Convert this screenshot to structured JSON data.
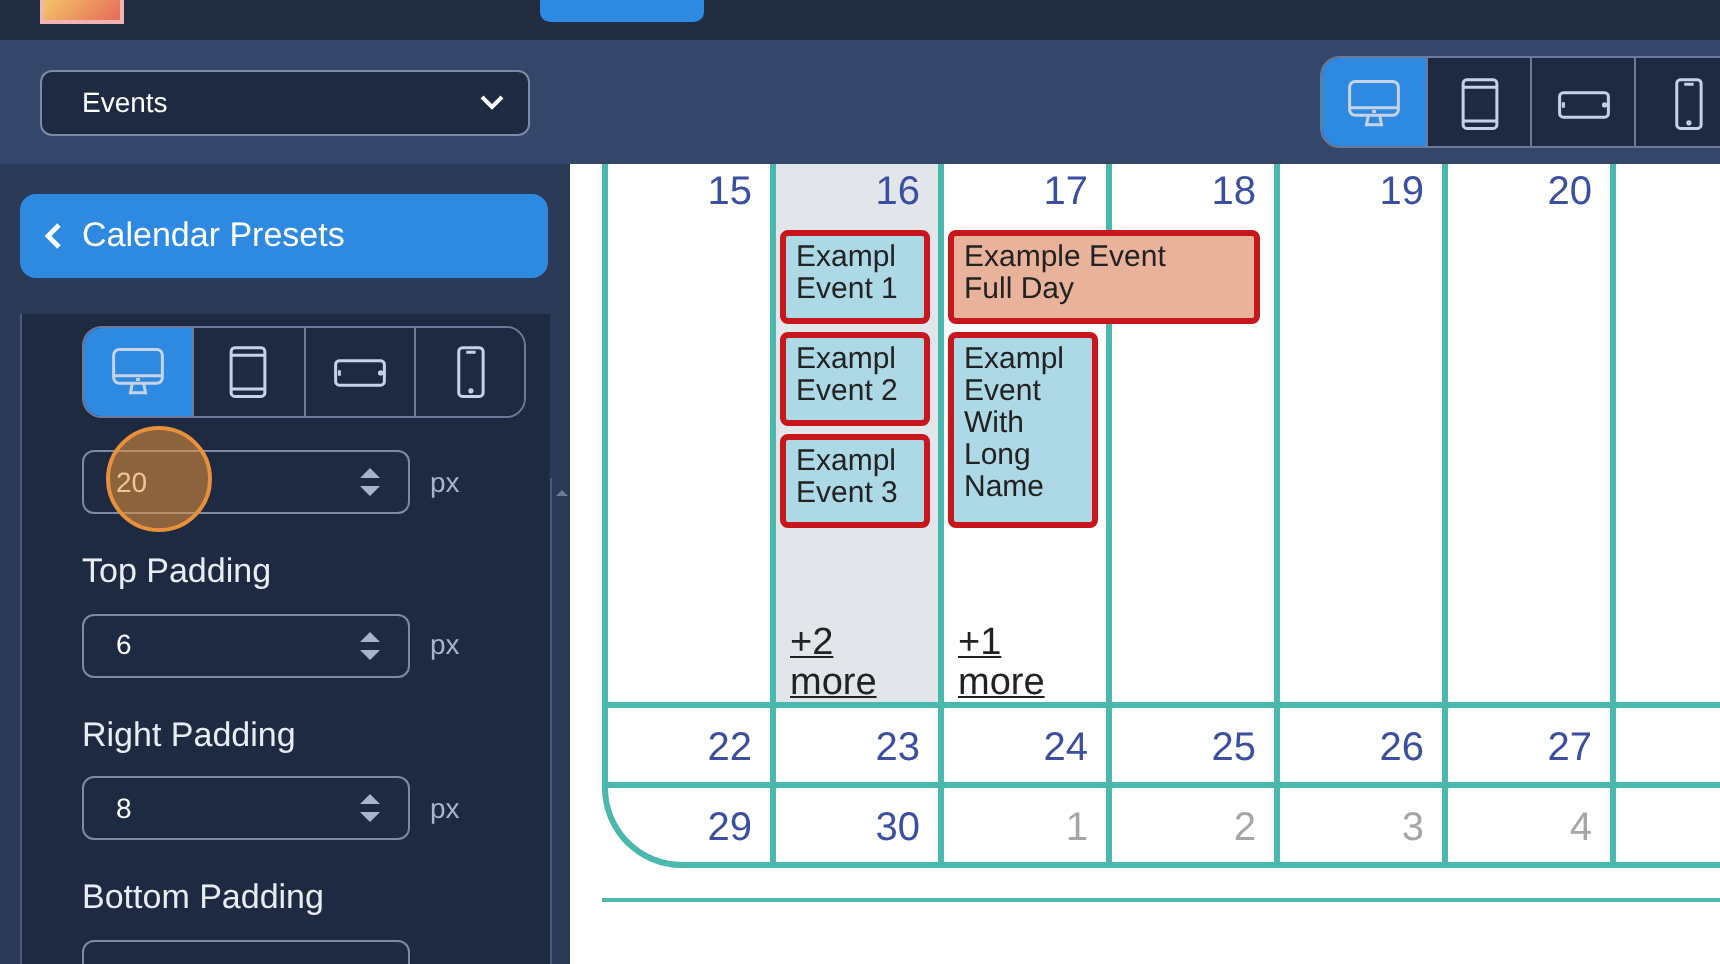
{
  "toolbar": {
    "view_select": {
      "value": "Events"
    },
    "devices": [
      {
        "kind": "desktop",
        "selected": true
      },
      {
        "kind": "tablet",
        "selected": false
      },
      {
        "kind": "landscape",
        "selected": false
      },
      {
        "kind": "phone",
        "selected": false
      }
    ]
  },
  "sidebar": {
    "back_button": {
      "label": "Calendar Presets"
    },
    "devices": [
      {
        "kind": "desktop",
        "selected": true
      },
      {
        "kind": "tablet",
        "selected": false
      },
      {
        "kind": "landscape",
        "selected": false
      },
      {
        "kind": "phone",
        "selected": false
      }
    ],
    "fields": [
      {
        "value": "20",
        "unit": "px"
      },
      {
        "label": "Top Padding",
        "value": "6",
        "unit": "px"
      },
      {
        "label": "Right Padding",
        "value": "8",
        "unit": "px"
      },
      {
        "label": "Bottom Padding"
      }
    ]
  },
  "calendar": {
    "weeks": [
      {
        "days": [
          {
            "day": "15",
            "muted": false,
            "selected": false
          },
          {
            "day": "16",
            "muted": false,
            "selected": true,
            "events": [
              {
                "kind": "single",
                "title": "Exampl Event 1",
                "color": "#add8e6"
              },
              {
                "kind": "single",
                "title": "Exampl Event 2",
                "color": "#add8e6"
              },
              {
                "kind": "single",
                "title": "Exampl Event 3",
                "color": "#add8e6"
              }
            ],
            "more": "+2 more"
          },
          {
            "day": "17",
            "muted": false,
            "selected": false,
            "events": [
              {
                "kind": "wide",
                "title": "Example Event Full Day",
                "color": "#e9b39b"
              },
              {
                "kind": "tall",
                "title": "Exampl Event With Long Name",
                "color": "#add8e6"
              }
            ],
            "more": "+1 more"
          },
          {
            "day": "18",
            "muted": false,
            "selected": false
          },
          {
            "day": "19",
            "muted": false,
            "selected": false
          },
          {
            "day": "20",
            "muted": false,
            "selected": false
          },
          {
            "selected": false
          }
        ]
      },
      {
        "days": [
          {
            "day": "22",
            "muted": false,
            "selected": false
          },
          {
            "day": "23",
            "muted": false,
            "selected": false
          },
          {
            "day": "24",
            "muted": false,
            "selected": false
          },
          {
            "day": "25",
            "muted": false,
            "selected": false
          },
          {
            "day": "26",
            "muted": false,
            "selected": false
          },
          {
            "day": "27",
            "muted": false,
            "selected": false
          },
          {
            "selected": false
          }
        ]
      },
      {
        "days": [
          {
            "day": "29",
            "muted": false,
            "selected": false
          },
          {
            "day": "30",
            "muted": false,
            "selected": false
          },
          {
            "day": "1",
            "muted": true,
            "selected": false
          },
          {
            "day": "2",
            "muted": true,
            "selected": false
          },
          {
            "day": "3",
            "muted": true,
            "selected": false
          },
          {
            "day": "4",
            "muted": true,
            "selected": false
          },
          {
            "selected": false
          }
        ]
      }
    ]
  }
}
